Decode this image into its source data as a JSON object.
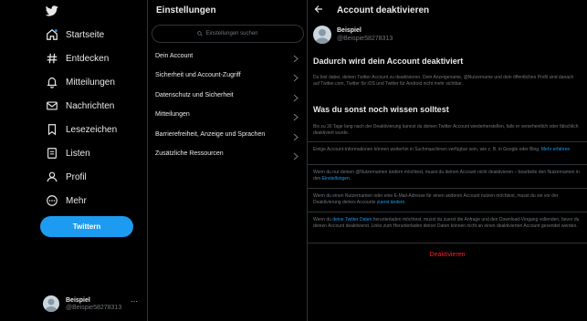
{
  "nav": {
    "logo_icon": "twitter-bird-icon",
    "items": [
      {
        "label": "Startseite",
        "icon": "home-icon"
      },
      {
        "label": "Entdecken",
        "icon": "hashtag-icon"
      },
      {
        "label": "Mitteilungen",
        "icon": "bell-icon"
      },
      {
        "label": "Nachrichten",
        "icon": "mail-icon"
      },
      {
        "label": "Lesezeichen",
        "icon": "bookmark-icon"
      },
      {
        "label": "Listen",
        "icon": "list-icon"
      },
      {
        "label": "Profil",
        "icon": "person-icon"
      },
      {
        "label": "Mehr",
        "icon": "more-circle-icon"
      }
    ],
    "tweet_button": "Twittern",
    "account": {
      "name": "Beispiel",
      "handle": "@Beispie58278313",
      "more": "···"
    }
  },
  "settings": {
    "title": "Einstellungen",
    "search_placeholder": "Einstellungen suchen",
    "items": [
      {
        "label": "Dein Account"
      },
      {
        "label": "Sicherheit und Account-Zugriff"
      },
      {
        "label": "Datenschutz und Sicherheit"
      },
      {
        "label": "Mitteilungen"
      },
      {
        "label": "Barrierefreiheit, Anzeige und Sprachen"
      },
      {
        "label": "Zusätzliche Ressourcen"
      }
    ]
  },
  "detail": {
    "title": "Account deaktivieren",
    "profile": {
      "name": "Beispiel",
      "handle": "@Beispie58278313"
    },
    "heading1": "Dadurch wird dein Account deaktiviert",
    "para1": "Du bist dabei, deinen Twitter Account zu deaktivieren. Dein Anzeigename, @Nutzername und dein öffentliches Profil sind danach auf Twitter.com, Twitter für iOS und Twitter für Android nicht mehr sichtbar.",
    "heading2": "Was du sonst noch wissen solltest",
    "para2": "Bis zu 30 Tage lang nach der Deaktivierung kannst du deinen Twitter Account wiederherstellen, falls er versehentlich oder fälschlich deaktiviert wurde.",
    "para3": {
      "text": "Einige Account-Informationen können weiterhin in Suchmaschinen verfügbar sein, wie z. B. in Google oder Bing.",
      "link": "Mehr erfahren"
    },
    "para4": {
      "text": "Wenn du nur deinen @Nutzernamen ändern möchtest, musst du deinen Account nicht deaktivieren – bearbeite den Nutzernamen in den",
      "link": "Einstellungen",
      "after": "."
    },
    "para5": {
      "text": "Wenn du einen Nutzernamen oder eine E-Mail-Adresse für einen anderen Account nutzen möchtest, musst du sie vor der Deaktivierung deines Accounts",
      "link": "zuerst ändern",
      "after": "."
    },
    "para6": {
      "before": "Wenn du",
      "link": "deine Twitter Daten",
      "text": "herunterladen möchtest, musst du zuerst die Anfrage und den Download-Vorgang vollenden, bevor du deinen Account deaktivierst. Links zum Herunterladen deiner Daten können nicht an einen deaktivierten Account gesendet werden."
    },
    "deactivate_label": "Deaktivieren"
  },
  "colors": {
    "accent": "#1d9bf0",
    "danger": "#f4212e",
    "background": "#000000",
    "muted": "#71767b"
  }
}
